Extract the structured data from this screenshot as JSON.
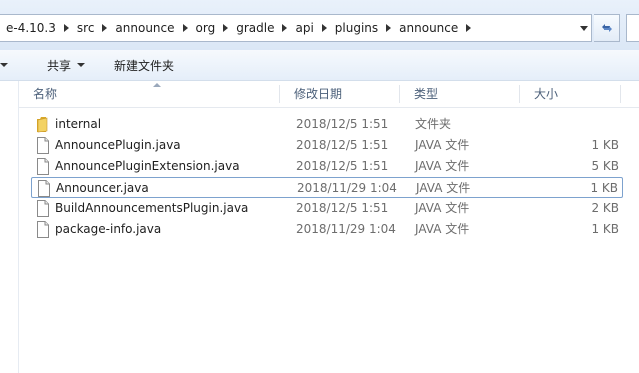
{
  "address_bar": {
    "crumbs": [
      "e-4.10.3",
      "src",
      "announce",
      "org",
      "gradle",
      "api",
      "plugins",
      "announce"
    ]
  },
  "toolbar": {
    "share_label": "共享",
    "new_folder_label": "新建文件夹"
  },
  "columns": {
    "name": "名称",
    "date": "修改日期",
    "type": "类型",
    "size": "大小"
  },
  "files": [
    {
      "name": "internal",
      "date": "2018/12/5 1:51",
      "type": "文件夹",
      "size": "",
      "icon": "folder-icon"
    },
    {
      "name": "AnnouncePlugin.java",
      "date": "2018/12/5 1:51",
      "type": "JAVA 文件",
      "size": "1 KB",
      "icon": "file-icon"
    },
    {
      "name": "AnnouncePluginExtension.java",
      "date": "2018/12/5 1:51",
      "type": "JAVA 文件",
      "size": "5 KB",
      "icon": "file-icon"
    },
    {
      "name": "Announcer.java",
      "date": "2018/11/29 1:04",
      "type": "JAVA 文件",
      "size": "1 KB",
      "icon": "file-icon"
    },
    {
      "name": "BuildAnnouncementsPlugin.java",
      "date": "2018/12/5 1:51",
      "type": "JAVA 文件",
      "size": "2 KB",
      "icon": "file-icon"
    },
    {
      "name": "package-info.java",
      "date": "2018/11/29 1:04",
      "type": "JAVA 文件",
      "size": "1 KB",
      "icon": "file-icon"
    }
  ],
  "colors": {
    "accent": "#3a64a5",
    "focus_border": "#7da2ce",
    "header_text": "#4c607a",
    "folder_yellow": "#e8c24a"
  }
}
